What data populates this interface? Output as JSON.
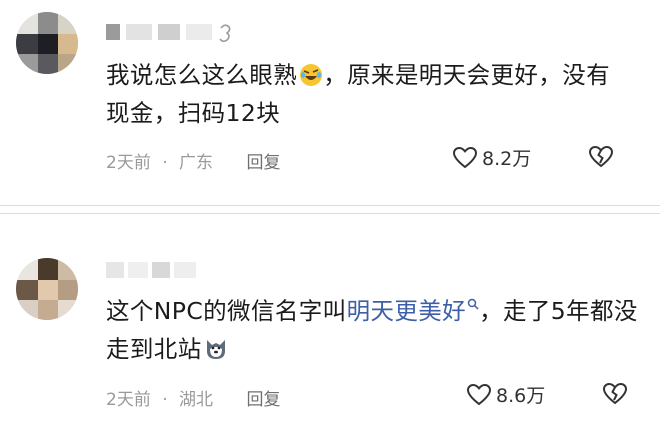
{
  "comments": [
    {
      "text_before": "我说怎么这么眼熟",
      "emoji": "rofl-emoji",
      "text_after": "，原来是明天会更好，没有现金，扫码12块",
      "time": "2天前",
      "location": "广东",
      "reply": "回复",
      "likes": "8.2万"
    },
    {
      "text_before": "这个NPC的微信名字叫",
      "link": "明天更美好",
      "text_after": "，走了5年都没走到北站",
      "emoji": "husky-emoji",
      "time": "2天前",
      "location": "湖北",
      "reply": "回复",
      "likes": "8.6万"
    }
  ],
  "colors": {
    "link": "#3d5fa8",
    "meta": "#9a9a9a",
    "text": "#1b1b1b"
  },
  "icons": [
    "heart-outline-icon",
    "heart-broken-icon",
    "search-icon"
  ]
}
